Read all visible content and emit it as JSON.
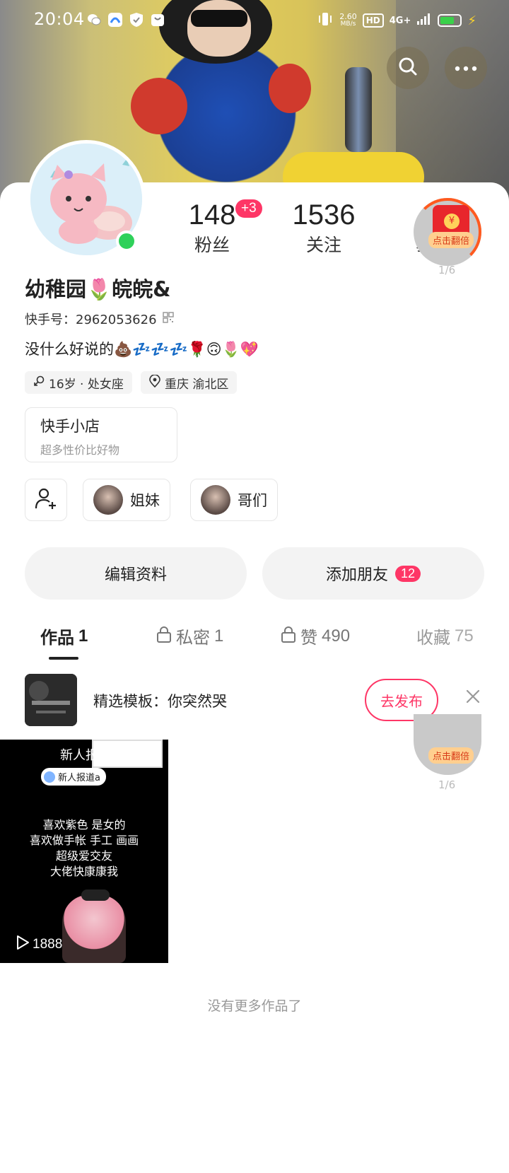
{
  "status_bar": {
    "time": "20:04",
    "speed_value": "2.60",
    "speed_unit": "MB/s",
    "hd": "HD",
    "network": "4G+",
    "icons": [
      "wechat-icon",
      "app-icon",
      "shield-icon",
      "bag-icon",
      "vibrate-icon",
      "signal-icon",
      "battery-icon",
      "charging-icon"
    ]
  },
  "header": {
    "search_icon": "search-icon",
    "more_icon": "more-icon"
  },
  "stats": {
    "fans_count": "148",
    "fans_new": "+3",
    "fans_label": "粉丝",
    "following_count": "1536",
    "following_label": "关注",
    "likes_label_partial": "获"
  },
  "red_packet": {
    "tag": "点击翻倍",
    "progress": "1/6",
    "coin": "¥"
  },
  "profile": {
    "nickname": "幼稚园🌷皖皖&",
    "id_label": "快手号：2962053626",
    "bio": "没什么好说的💩💤💤💤🌹🙃🌷💖",
    "age_tag": "16岁 · 处女座",
    "location_tag": "重庆 渝北区"
  },
  "shop": {
    "title": "快手小店",
    "subtitle": "超多性价比好物"
  },
  "groups": {
    "sisters": "姐妹",
    "brothers": "哥们"
  },
  "actions": {
    "edit_profile": "编辑资料",
    "add_friend": "添加朋友",
    "add_friend_count": "12"
  },
  "tabs": [
    {
      "label": "作品",
      "count": "1"
    },
    {
      "label": "私密",
      "count": "1"
    },
    {
      "label": "赞",
      "count": "490"
    },
    {
      "label": "收藏",
      "count": "75"
    }
  ],
  "template_banner": {
    "text": "精选模板：你突然哭",
    "button": "去发布"
  },
  "works": [
    {
      "title": "新人报",
      "tag": "新人报道a",
      "lines": [
        "喜欢紫色 是女的",
        "喜欢做手帐 手工 画画",
        "超级爱交友",
        "大佬快康康我"
      ],
      "play_count": "1888"
    }
  ],
  "footer": {
    "no_more": "没有更多作品了"
  },
  "colors": {
    "accent": "#fe3666",
    "online": "#2fd15a",
    "text_primary": "#222222",
    "text_secondary": "#999999"
  }
}
